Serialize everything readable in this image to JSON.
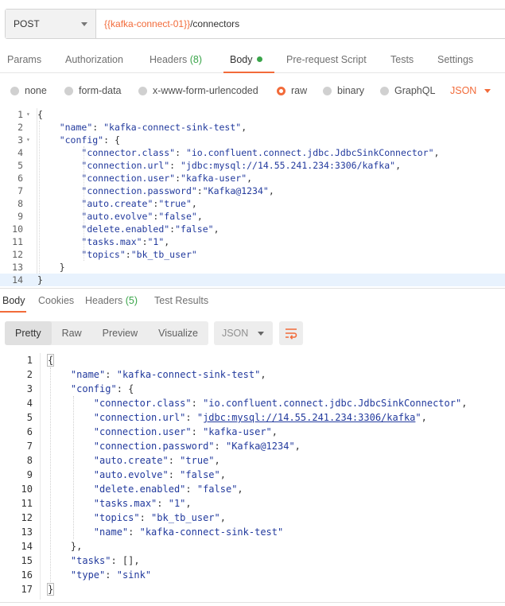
{
  "request": {
    "method": "POST",
    "url_variable": "{{kafka-connect-01}}",
    "url_path": "/connectors"
  },
  "request_tabs": [
    {
      "label": "Params"
    },
    {
      "label": "Authorization"
    },
    {
      "label": "Headers",
      "count": "(8)"
    },
    {
      "label": "Body"
    },
    {
      "label": "Pre-request Script"
    },
    {
      "label": "Tests"
    },
    {
      "label": "Settings"
    }
  ],
  "body_types": [
    {
      "label": "none"
    },
    {
      "label": "form-data"
    },
    {
      "label": "x-www-form-urlencoded"
    },
    {
      "label": "raw"
    },
    {
      "label": "binary"
    },
    {
      "label": "GraphQL"
    }
  ],
  "body_format": "JSON",
  "editor": {
    "line_numbers": [
      "1",
      "2",
      "3",
      "4",
      "5",
      "6",
      "7",
      "8",
      "9",
      "10",
      "11",
      "12",
      "13",
      "14"
    ],
    "lines": [
      "{",
      "    \"name\": \"kafka-connect-sink-test\",",
      "    \"config\": {",
      "        \"connector.class\": \"io.confluent.connect.jdbc.JdbcSinkConnector\",",
      "        \"connection.url\": \"jdbc:mysql://14.55.241.234:3306/kafka\",",
      "        \"connection.user\":\"kafka-user\",",
      "        \"connection.password\":\"Kafka@1234\",",
      "        \"auto.create\":\"true\",",
      "        \"auto.evolve\":\"false\",",
      "        \"delete.enabled\":\"false\",",
      "        \"tasks.max\":\"1\",",
      "        \"topics\":\"bk_tb_user\"",
      "    }",
      "}"
    ]
  },
  "response_tabs": [
    {
      "label": "Body"
    },
    {
      "label": "Cookies"
    },
    {
      "label": "Headers",
      "count": "(5)"
    },
    {
      "label": "Test Results"
    }
  ],
  "view_modes": [
    {
      "label": "Pretty"
    },
    {
      "label": "Raw"
    },
    {
      "label": "Preview"
    },
    {
      "label": "Visualize"
    }
  ],
  "response_format": "JSON",
  "response": {
    "line_numbers": [
      "1",
      "2",
      "3",
      "4",
      "5",
      "6",
      "7",
      "8",
      "9",
      "10",
      "11",
      "12",
      "13",
      "14",
      "15",
      "16",
      "17"
    ],
    "lines": [
      "{",
      "    \"name\": \"kafka-connect-sink-test\",",
      "    \"config\": {",
      "        \"connector.class\": \"io.confluent.connect.jdbc.JdbcSinkConnector\",",
      "        \"connection.url\": \"jdbc:mysql://14.55.241.234:3306/kafka\",",
      "        \"connection.user\": \"kafka-user\",",
      "        \"connection.password\": \"Kafka@1234\",",
      "        \"auto.create\": \"true\",",
      "        \"auto.evolve\": \"false\",",
      "        \"delete.enabled\": \"false\",",
      "        \"tasks.max\": \"1\",",
      "        \"topics\": \"bk_tb_user\",",
      "        \"name\": \"kafka-connect-sink-test\"",
      "    },",
      "    \"tasks\": [],",
      "    \"type\": \"sink\"",
      "}"
    ]
  },
  "colors": {
    "accent": "#f26b3a",
    "count_green": "#3aa54a",
    "json_key": "#223a9d"
  }
}
